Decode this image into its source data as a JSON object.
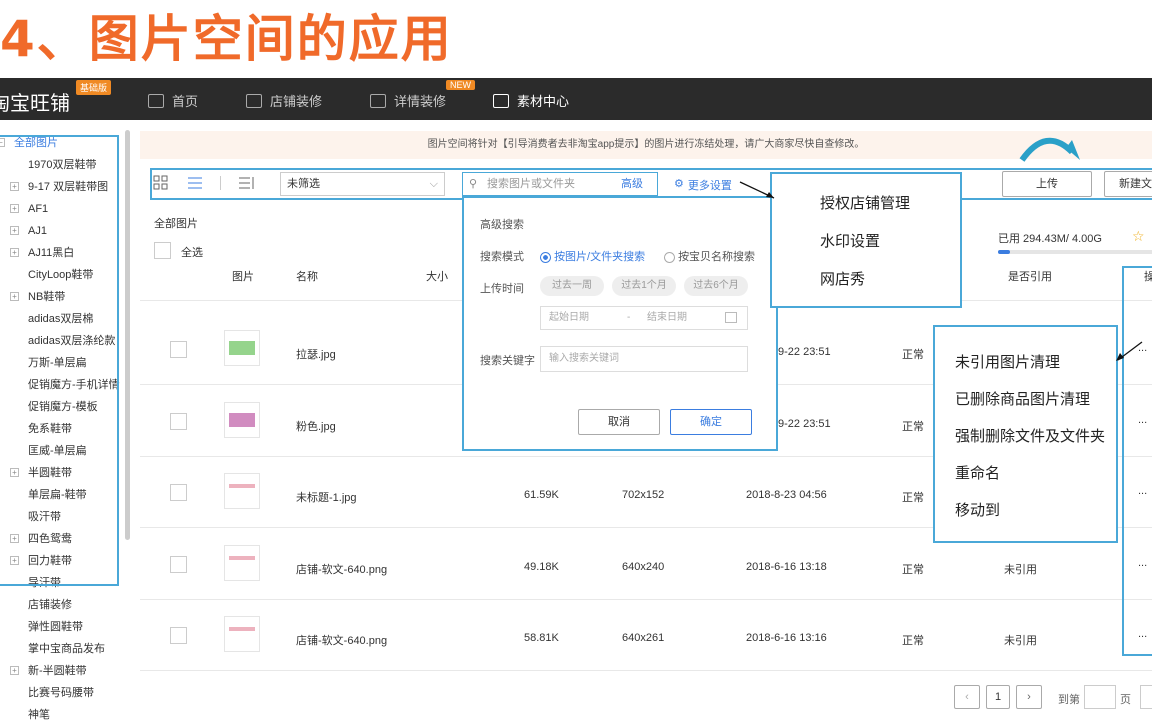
{
  "slide_title": "4、图片空间的应用",
  "nav": {
    "brand": "淘宝旺铺",
    "brand_badge": "基础版",
    "items": [
      {
        "label": "首页",
        "icon": "home-icon"
      },
      {
        "label": "店铺装修",
        "icon": "shop-decor-icon"
      },
      {
        "label": "详情装修",
        "icon": "detail-decor-icon",
        "badge": "NEW"
      },
      {
        "label": "素材中心",
        "icon": "folder-icon",
        "active": true
      }
    ]
  },
  "sidebar": {
    "root": "全部图片",
    "items": [
      {
        "label": "1970双层鞋带",
        "expandable": false
      },
      {
        "label": "9-17 双层鞋带图",
        "expandable": true
      },
      {
        "label": "AF1",
        "expandable": true
      },
      {
        "label": "AJ1",
        "expandable": true
      },
      {
        "label": "AJ11黑白",
        "expandable": true
      },
      {
        "label": "CityLoop鞋带",
        "expandable": false
      },
      {
        "label": "NB鞋带",
        "expandable": true
      },
      {
        "label": "adidas双层棉",
        "expandable": false
      },
      {
        "label": "adidas双层涤纶款",
        "expandable": false
      },
      {
        "label": "万斯-单层扁",
        "expandable": false
      },
      {
        "label": "促销魔方-手机详情",
        "expandable": false
      },
      {
        "label": "促销魔方-模板",
        "expandable": false
      },
      {
        "label": "免系鞋带",
        "expandable": false
      },
      {
        "label": "匡威-单层扁",
        "expandable": false
      },
      {
        "label": "半圆鞋带",
        "expandable": true
      },
      {
        "label": "单层扁-鞋带",
        "expandable": false
      },
      {
        "label": "吸汗带",
        "expandable": false
      },
      {
        "label": "四色鸳鸯",
        "expandable": true
      },
      {
        "label": "回力鞋带",
        "expandable": true
      },
      {
        "label": "导汗带",
        "expandable": false
      },
      {
        "label": "店铺装修",
        "expandable": false
      },
      {
        "label": "弹性圆鞋带",
        "expandable": false
      },
      {
        "label": "掌中宝商品发布",
        "expandable": false
      },
      {
        "label": "新-半圆鞋带",
        "expandable": true
      },
      {
        "label": "比赛号码腰带",
        "expandable": false
      },
      {
        "label": "神笔",
        "expandable": false
      }
    ]
  },
  "notice": "图片空间将针对【引导消费者去非淘宝app提示】的图片进行冻结处理，请广大商家尽快自查修改。",
  "toolbar": {
    "filter_value": "未筛选",
    "search_placeholder": "搜索图片或文件夹",
    "advanced_label": "高级",
    "more_settings": "更多设置",
    "upload_label": "上传",
    "new_folder_label": "新建文"
  },
  "advanced_search": {
    "title": "高级搜索",
    "mode_label": "搜索模式",
    "mode_options": [
      "按图片/文件夹搜索",
      "按宝贝名称搜索"
    ],
    "time_label": "上传时间",
    "time_options": [
      "过去一周",
      "过去1个月",
      "过去6个月"
    ],
    "start_placeholder": "起始日期",
    "date_sep": "-",
    "end_placeholder": "结束日期",
    "keyword_label": "搜索关键字",
    "keyword_placeholder": "输入搜索关键词",
    "cancel": "取消",
    "confirm": "确定"
  },
  "more_settings_menu": [
    "授权店铺管理",
    "水印设置",
    "网店秀"
  ],
  "action_menu": [
    "未引用图片清理",
    "已删除商品图片清理",
    "强制删除文件及文件夹",
    "重命名",
    "移动到"
  ],
  "storage": {
    "text": "已用 294.43M/ 4.00G",
    "used_fraction": 0.0719
  },
  "content": {
    "breadcrumb": "全部图片",
    "select_all": "全选",
    "columns": [
      "图片",
      "名称",
      "大小",
      "是否引用",
      "操"
    ],
    "rows": [
      {
        "name": "拉瑟.jpg",
        "size": "",
        "dims": "",
        "date": "9-22 23:51",
        "status": "正常",
        "ref": "",
        "more": "..."
      },
      {
        "name": "粉色.jpg",
        "size": "",
        "dims": "",
        "date": "9-22 23:51",
        "status": "正常",
        "ref": "",
        "more": "..."
      },
      {
        "name": "未标题-1.jpg",
        "size": "61.59K",
        "dims": "702x152",
        "date": "2018-8-23 04:56",
        "status": "正常",
        "ref": "",
        "more": "..."
      },
      {
        "name": "店铺-软文-640.png",
        "size": "49.18K",
        "dims": "640x240",
        "date": "2018-6-16 13:18",
        "status": "正常",
        "ref": "未引用",
        "more": "..."
      },
      {
        "name": "店铺-软文-640.png",
        "size": "58.81K",
        "dims": "640x261",
        "date": "2018-6-16 13:16",
        "status": "正常",
        "ref": "未引用",
        "more": "..."
      }
    ]
  },
  "pagination": {
    "current": "1",
    "goto_label": "到第",
    "page_label": "页"
  },
  "colors": {
    "accent_title": "#f06a2a",
    "frame_blue": "#4aa8d8",
    "nav_bg": "#2b2b2b",
    "link_blue": "#3b7de0"
  }
}
